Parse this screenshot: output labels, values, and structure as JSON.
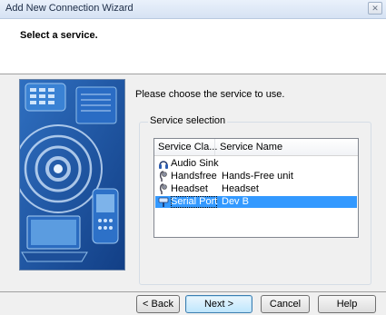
{
  "window": {
    "title": "Add New Connection Wizard",
    "close_glyph": "✕"
  },
  "header": {
    "title": "Select a service."
  },
  "content": {
    "instruction": "Please choose the service to use.",
    "group_label": "Service selection",
    "columns": [
      "Service Cla...",
      "Service Name"
    ],
    "rows": [
      {
        "class": "Audio Sink",
        "name": "",
        "icon": "headphones-icon",
        "selected": false
      },
      {
        "class": "Handsfree",
        "name": "Hands-Free unit",
        "icon": "headset-icon",
        "selected": false
      },
      {
        "class": "Headset",
        "name": "Headset",
        "icon": "headset-icon",
        "selected": false
      },
      {
        "class": "Serial Port",
        "name": "Dev B",
        "icon": "serial-port-icon",
        "selected": true
      }
    ]
  },
  "buttons": {
    "back": "< Back",
    "next": "Next >",
    "cancel": "Cancel",
    "help": "Help"
  },
  "colors": {
    "selection": "#3399ff",
    "header_bg": "#ffffff",
    "art_blue": "#1f5ba8"
  }
}
